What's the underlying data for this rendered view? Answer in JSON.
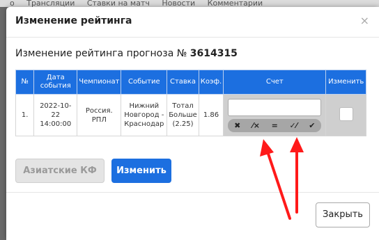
{
  "backdrop": {
    "items": [
      "о",
      "Трансляции",
      "Ставки на матч",
      "Новости",
      "Комментарии"
    ]
  },
  "modal": {
    "title": "Изменение рейтинга",
    "close_glyph": "×",
    "subtitle_prefix": "Изменение рейтинга прогноза №",
    "forecast_number": "3614315"
  },
  "table": {
    "headers": [
      "№",
      "Дата события",
      "Чемпионат",
      "Событие",
      "Ставка",
      "Коэф.",
      "Счет",
      "Изменить"
    ],
    "row": {
      "num": "1.",
      "date": "2022-10-22 14:00:00",
      "championship": "Россия. РПЛ",
      "event": "Нижний Новгород - Краснодар",
      "bet": "Тотал Больше (2.25)",
      "coef": "1.86",
      "score_value": ""
    },
    "score_buttons": [
      {
        "name": "lose-icon",
        "glyph": "✖"
      },
      {
        "name": "half-lose-icon",
        "glyph": "⁄×"
      },
      {
        "name": "return-icon",
        "glyph": "="
      },
      {
        "name": "half-win-icon",
        "glyph": "✓⁄"
      },
      {
        "name": "win-icon",
        "glyph": "✔"
      }
    ]
  },
  "buttons": {
    "asian": "Азиатские КФ",
    "change": "Изменить",
    "close": "Закрыть"
  },
  "colors": {
    "accent": "#1c6fe0",
    "arrow": "#ff1a1a"
  }
}
